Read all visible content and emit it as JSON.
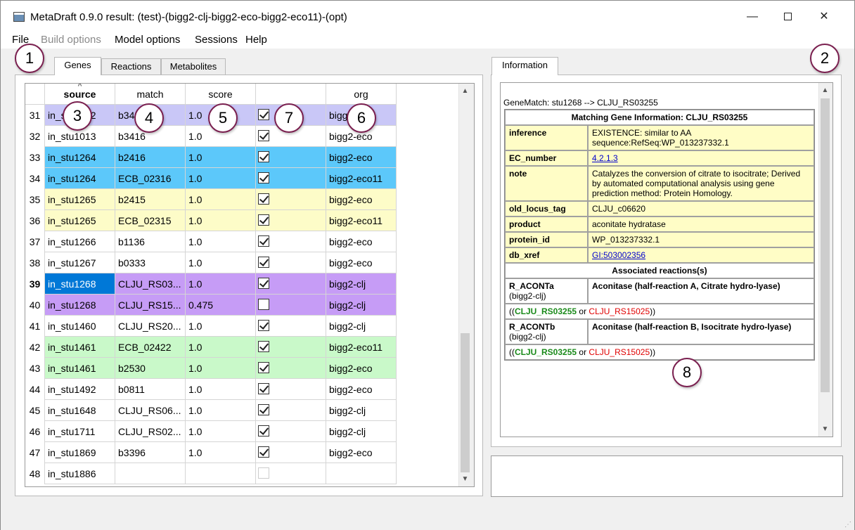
{
  "window": {
    "title": "MetaDraft 0.9.0 result: (test)-(bigg2-clj-bigg2-eco-bigg2-eco11)-(opt)",
    "minimize": "—",
    "close": "✕"
  },
  "menu": [
    "File",
    "Build options",
    "Model options",
    "Sessions",
    "Help"
  ],
  "left_tabs": [
    "Genes",
    "Reactions",
    "Metabolites"
  ],
  "right_tab": "Information",
  "grid": {
    "columns": [
      "source",
      "match",
      "score",
      "",
      "org"
    ],
    "sort_indicator": "^",
    "rows": [
      {
        "num": "31",
        "source": "in_stu1012",
        "match": "b3417",
        "score": "1.0",
        "checked": true,
        "org": "bigg2-eco",
        "bg": "#c9c7f7"
      },
      {
        "num": "32",
        "source": "in_stu1013",
        "match": "b3416",
        "score": "1.0",
        "checked": true,
        "org": "bigg2-eco",
        "bg": "#ffffff"
      },
      {
        "num": "33",
        "source": "in_stu1264",
        "match": "b2416",
        "score": "1.0",
        "checked": true,
        "org": "bigg2-eco",
        "bg": "#5cc8fa"
      },
      {
        "num": "34",
        "source": "in_stu1264",
        "match": "ECB_02316",
        "score": "1.0",
        "checked": true,
        "org": "bigg2-eco11",
        "bg": "#5cc8fa"
      },
      {
        "num": "35",
        "source": "in_stu1265",
        "match": "b2415",
        "score": "1.0",
        "checked": true,
        "org": "bigg2-eco",
        "bg": "#fdfcc8"
      },
      {
        "num": "36",
        "source": "in_stu1265",
        "match": "ECB_02315",
        "score": "1.0",
        "checked": true,
        "org": "bigg2-eco11",
        "bg": "#fdfcc8"
      },
      {
        "num": "37",
        "source": "in_stu1266",
        "match": "b1136",
        "score": "1.0",
        "checked": true,
        "org": "bigg2-eco",
        "bg": "#ffffff"
      },
      {
        "num": "38",
        "source": "in_stu1267",
        "match": "b0333",
        "score": "1.0",
        "checked": true,
        "org": "bigg2-eco",
        "bg": "#ffffff"
      },
      {
        "num": "39",
        "source": "in_stu1268",
        "match": "CLJU_RS03...",
        "score": "1.0",
        "checked": true,
        "org": "bigg2-clj",
        "bg": "#c69cf6",
        "selected": true
      },
      {
        "num": "40",
        "source": "in_stu1268",
        "match": "CLJU_RS15...",
        "score": "0.475",
        "checked": false,
        "org": "bigg2-clj",
        "bg": "#c69cf6"
      },
      {
        "num": "41",
        "source": "in_stu1460",
        "match": "CLJU_RS20...",
        "score": "1.0",
        "checked": true,
        "org": "bigg2-clj",
        "bg": "#ffffff"
      },
      {
        "num": "42",
        "source": "in_stu1461",
        "match": "ECB_02422",
        "score": "1.0",
        "checked": true,
        "org": "bigg2-eco11",
        "bg": "#c9f9c9"
      },
      {
        "num": "43",
        "source": "in_stu1461",
        "match": "b2530",
        "score": "1.0",
        "checked": true,
        "org": "bigg2-eco",
        "bg": "#c9f9c9"
      },
      {
        "num": "44",
        "source": "in_stu1492",
        "match": "b0811",
        "score": "1.0",
        "checked": true,
        "org": "bigg2-eco",
        "bg": "#ffffff"
      },
      {
        "num": "45",
        "source": "in_stu1648",
        "match": "CLJU_RS06...",
        "score": "1.0",
        "checked": true,
        "org": "bigg2-clj",
        "bg": "#ffffff"
      },
      {
        "num": "46",
        "source": "in_stu1711",
        "match": "CLJU_RS02...",
        "score": "1.0",
        "checked": true,
        "org": "bigg2-clj",
        "bg": "#ffffff"
      },
      {
        "num": "47",
        "source": "in_stu1869",
        "match": "b3396",
        "score": "1.0",
        "checked": true,
        "org": "bigg2-eco",
        "bg": "#ffffff"
      },
      {
        "num": "48",
        "source": "in_stu1886",
        "match": "",
        "score": "",
        "checked": false,
        "disabled": true,
        "org": "",
        "bg": "#ffffff"
      }
    ]
  },
  "info": {
    "genematch": "GeneMatch: stu1268 --> CLJU_RS03255",
    "heading": "Matching Gene Information: CLJU_RS03255",
    "fields": [
      {
        "key": "inference",
        "value": "EXISTENCE: similar to AA sequence:RefSeq:WP_013237332.1"
      },
      {
        "key": "EC_number",
        "value": "4.2.1.3",
        "link": true
      },
      {
        "key": "note",
        "value": "Catalyzes the conversion of citrate to isocitrate; Derived by automated computational analysis using gene prediction method: Protein Homology."
      },
      {
        "key": "old_locus_tag",
        "value": "CLJU_c06620"
      },
      {
        "key": "product",
        "value": "aconitate hydratase"
      },
      {
        "key": "protein_id",
        "value": "WP_013237332.1"
      },
      {
        "key": "db_xref",
        "value": "GI:503002356",
        "link": true
      }
    ],
    "reactions_heading": "Associated reactions(s)",
    "reactions": [
      {
        "id": "R_ACONTa",
        "model": "(bigg2-clj)",
        "name": "Aconitase (half-reaction A, Citrate hydro-lyase)",
        "gpr_open": "((",
        "gene_a": "CLJU_RS03255",
        "or": " or ",
        "gene_b": "CLJU_RS15025",
        "gpr_close": "))"
      },
      {
        "id": "R_ACONTb",
        "model": "(bigg2-clj)",
        "name": "Aconitase (half-reaction B, Isocitrate hydro-lyase)",
        "gpr_open": "((",
        "gene_a": "CLJU_RS03255",
        "or": " or ",
        "gene_b": "CLJU_RS15025",
        "gpr_close": "))"
      }
    ]
  },
  "badges": [
    "1",
    "2",
    "3",
    "4",
    "5",
    "6",
    "7",
    "8"
  ],
  "colors": {
    "badge_border": "#7a1f4f",
    "selected_cell": "#0078d7",
    "info_bg": "#fffdc6"
  }
}
